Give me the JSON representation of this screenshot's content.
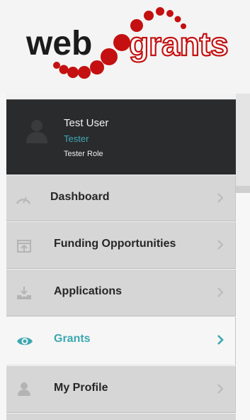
{
  "brand": {
    "logo_part1": "web",
    "logo_part2": "grants",
    "colors": {
      "dark": "#1b1b1b",
      "red": "#cc1010"
    }
  },
  "user": {
    "name": "Test User",
    "title": "Tester",
    "role": "Tester Role",
    "avatar_icon": "user-silhouette-icon"
  },
  "nav": {
    "items": [
      {
        "label": "Dashboard",
        "icon": "dashboard-icon",
        "active": false
      },
      {
        "label": "Funding Opportunities",
        "icon": "funding-opportunities-icon",
        "active": false
      },
      {
        "label": "Applications",
        "icon": "applications-icon",
        "active": false
      },
      {
        "label": "Grants",
        "icon": "eye-icon",
        "active": true
      },
      {
        "label": "My Profile",
        "icon": "user-icon",
        "active": false
      }
    ],
    "accent_color": "#3ba7b2"
  }
}
